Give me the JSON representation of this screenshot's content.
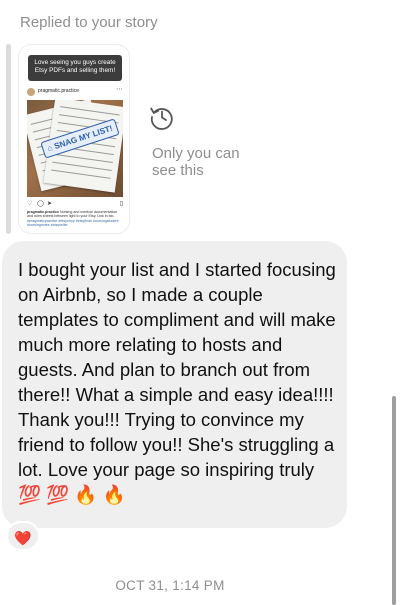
{
  "header": {
    "replied_label": "Replied to your story"
  },
  "story": {
    "banner_text": "Love seeing you guys create Etsy PDFs and selling them!",
    "post_username": "pragmatic.practice",
    "stamp_text": "SNAG MY LIST!",
    "caption_user": "pragmatic.practice",
    "caption_text": "Nursing and medical documentation and rules sheets between light to your Etsy. Link in bio.",
    "caption_tags": "#pragmaticpractice #etsyshop #etsyfinds #nursingstudent #nursingnotes #etsyseller",
    "icons": [
      "more-icon",
      "heart-icon",
      "comment-icon",
      "share-icon",
      "bookmark-icon"
    ]
  },
  "visibility": {
    "icon": "history-icon",
    "text": "Only you can see this"
  },
  "message": {
    "text": "I bought your list and I started focusing on Airbnb, so I made a couple templates to compliment and will make much more relating to hosts and guests. And plan to branch out from there!! What a simple and easy idea!!!! Thank you!!! Trying to convince my friend to follow you!! She's struggling a lot. Love your page so inspiring truly\n💯 💯 🔥 🔥",
    "reaction": "❤️"
  },
  "timestamp": "OCT 31, 1:14 PM",
  "colors": {
    "bubble": "#efefef",
    "muted": "#8e8e8e",
    "stamp": "#2d5fae"
  }
}
